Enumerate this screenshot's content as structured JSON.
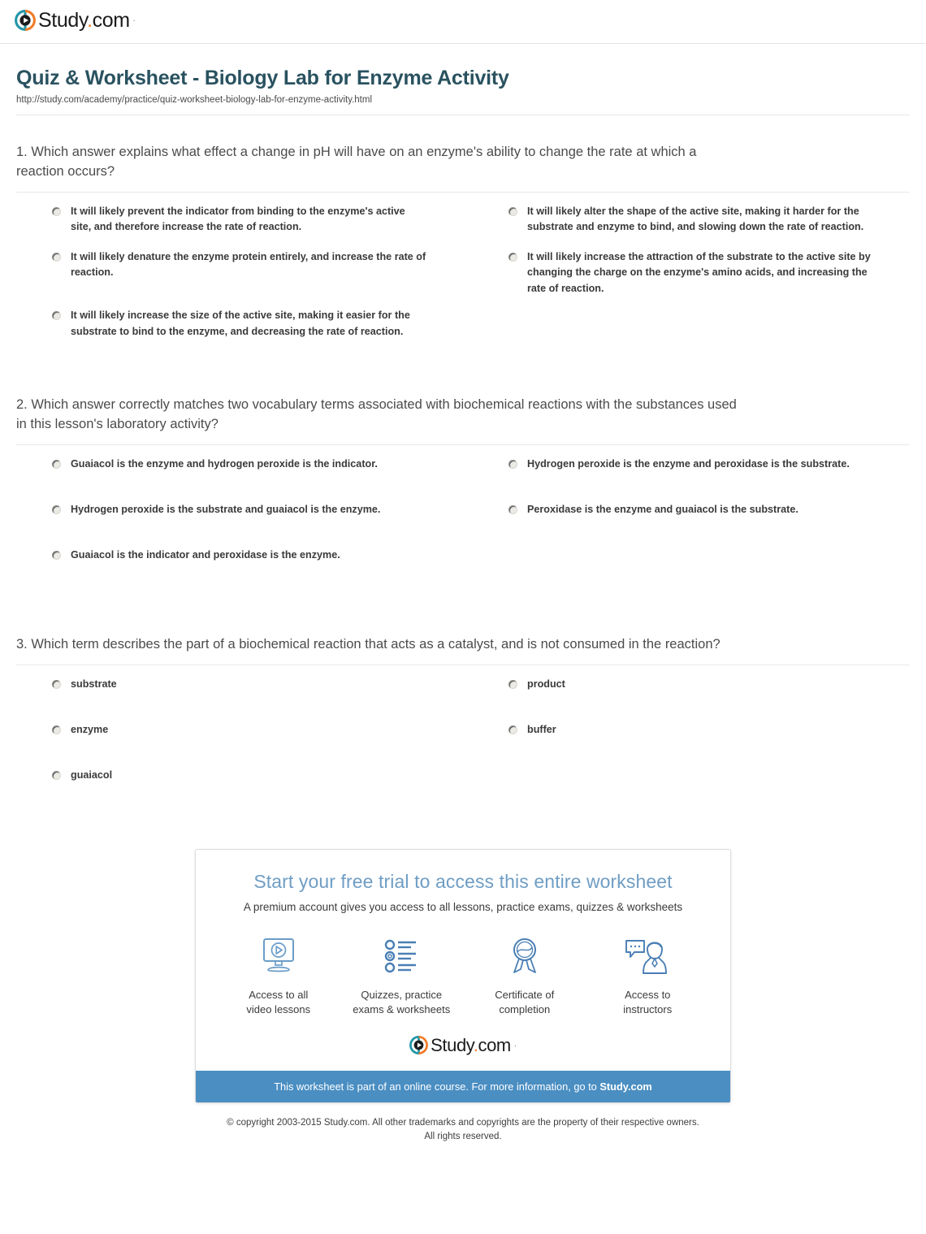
{
  "brand": {
    "name_study": "Study",
    "name_dot": ".",
    "name_com": "com",
    "trademark": "·",
    "logo_teal": "#2196a8",
    "logo_orange": "#f07c2a"
  },
  "header": {
    "title": "Quiz & Worksheet - Biology Lab for Enzyme Activity",
    "url": "http://study.com/academy/practice/quiz-worksheet-biology-lab-for-enzyme-activity.html",
    "title_color": "#2a5260"
  },
  "questions": [
    {
      "text": "1. Which answer explains what effect a change in pH will have on an enzyme's ability to change the rate at which a reaction occurs?",
      "options": [
        "It will likely prevent the indicator from binding to the enzyme's active site, and therefore increase the rate of reaction.",
        "It will likely alter the shape of the active site, making it harder for the substrate and enzyme to bind, and slowing down the rate of reaction.",
        "It will likely denature the enzyme protein entirely, and increase the rate of reaction.",
        "It will likely increase the attraction of the substrate to the active site by changing the charge on the enzyme's amino acids, and increasing the rate of reaction.",
        "It will likely increase the size of the active site, making it easier for the substrate to bind to the enzyme, and decreasing the rate of reaction."
      ]
    },
    {
      "text": "2. Which answer correctly matches two vocabulary terms associated with biochemical reactions with the substances used in this lesson's laboratory activity?",
      "options": [
        "Guaiacol is the enzyme and hydrogen peroxide is the indicator.",
        "Hydrogen peroxide is the enzyme and peroxidase is the substrate.",
        "Hydrogen peroxide is the substrate and guaiacol is the enzyme.",
        "Peroxidase is the enzyme and guaiacol is the substrate.",
        "Guaiacol is the indicator and peroxidase is the enzyme."
      ]
    },
    {
      "text": "3. Which term describes the part of a biochemical reaction that acts as a catalyst, and is not consumed in the reaction?",
      "options": [
        "substrate",
        "product",
        "enzyme",
        "buffer",
        "guaiacol"
      ]
    }
  ],
  "promo": {
    "title": "Start your free trial to access this entire worksheet",
    "subtitle": "A premium account gives you access to all lessons, practice exams, quizzes & worksheets",
    "perks": [
      {
        "icon": "monitor-play-icon",
        "label": "Access to all\nvideo lessons"
      },
      {
        "icon": "checklist-icon",
        "label": "Quizzes, practice\nexams & worksheets"
      },
      {
        "icon": "award-ribbon-icon",
        "label": "Certificate of\ncompletion"
      },
      {
        "icon": "instructor-chat-icon",
        "label": "Access to\ninstructors"
      }
    ],
    "bar_text": "This worksheet is part of an online course. For more information, go to ",
    "bar_link": "Study.com",
    "bar_color": "#4a8ec2",
    "title_color": "#6f9dc4"
  },
  "copyright": "© copyright 2003-2015 Study.com. All other trademarks and copyrights are the property of their respective owners.\nAll rights reserved."
}
